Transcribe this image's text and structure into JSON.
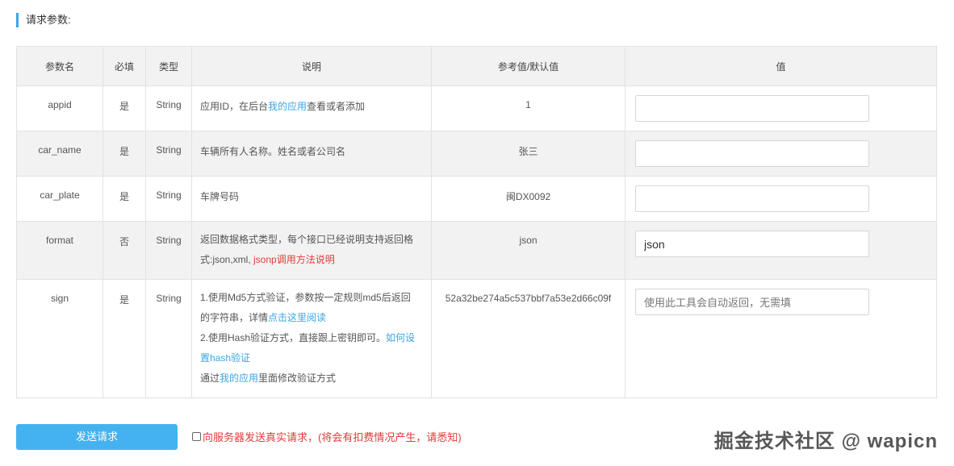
{
  "section_title": "请求参数:",
  "table": {
    "headers": [
      "参数名",
      "必填",
      "类型",
      "说明",
      "参考值/默认值",
      "值"
    ],
    "rows": [
      {
        "name": "appid",
        "required": "是",
        "type": "String",
        "desc_pre": "应用ID，在后台",
        "desc_link": "我的应用",
        "desc_post": "查看或者添加",
        "ref": "1",
        "value": "",
        "placeholder": ""
      },
      {
        "name": "car_name",
        "required": "是",
        "type": "String",
        "desc": "车辆所有人名称。姓名或者公司名",
        "ref": "张三",
        "value": "",
        "placeholder": ""
      },
      {
        "name": "car_plate",
        "required": "是",
        "type": "String",
        "desc": "车牌号码",
        "ref": "闽DX0092",
        "value": "",
        "placeholder": ""
      },
      {
        "name": "format",
        "required": "否",
        "type": "String",
        "desc_line1": "返回数据格式类型，每个接口已经说明支持返回格",
        "desc_line2_pre": "式:json,xml, ",
        "desc_line2_link": "jsonp调用方法说明",
        "ref": "json",
        "value": "json",
        "placeholder": ""
      },
      {
        "name": "sign",
        "required": "是",
        "type": "String",
        "desc_line1": "1.使用Md5方式验证，参数按一定规则md5后返回",
        "desc_line2_pre": "的字符串，详情",
        "desc_line2_link": "点击这里阅读",
        "desc_line3_pre": "2.使用Hash验证方式，直接跟上密钥即可。",
        "desc_line3_link": "如何设",
        "desc_line4_link": "置hash验证",
        "desc_line5_pre": "通过",
        "desc_line5_link": "我的应用",
        "desc_line5_post": "里面修改验证方式",
        "ref": "52a32be274a5c537bbf7a53e2d66c09f",
        "value": "",
        "placeholder": "使用此工具会自动返回，无需填"
      }
    ]
  },
  "send_button": "发送请求",
  "real_request_label": "向服务器发送真实请求，(将会有扣费情况产生，请悉知)",
  "watermark": "掘金技术社区 @ wapicn",
  "colors": {
    "accent": "#45b2f0",
    "link": "#3aa5e8",
    "required": "#d9534f",
    "warning": "#e23b3b"
  }
}
